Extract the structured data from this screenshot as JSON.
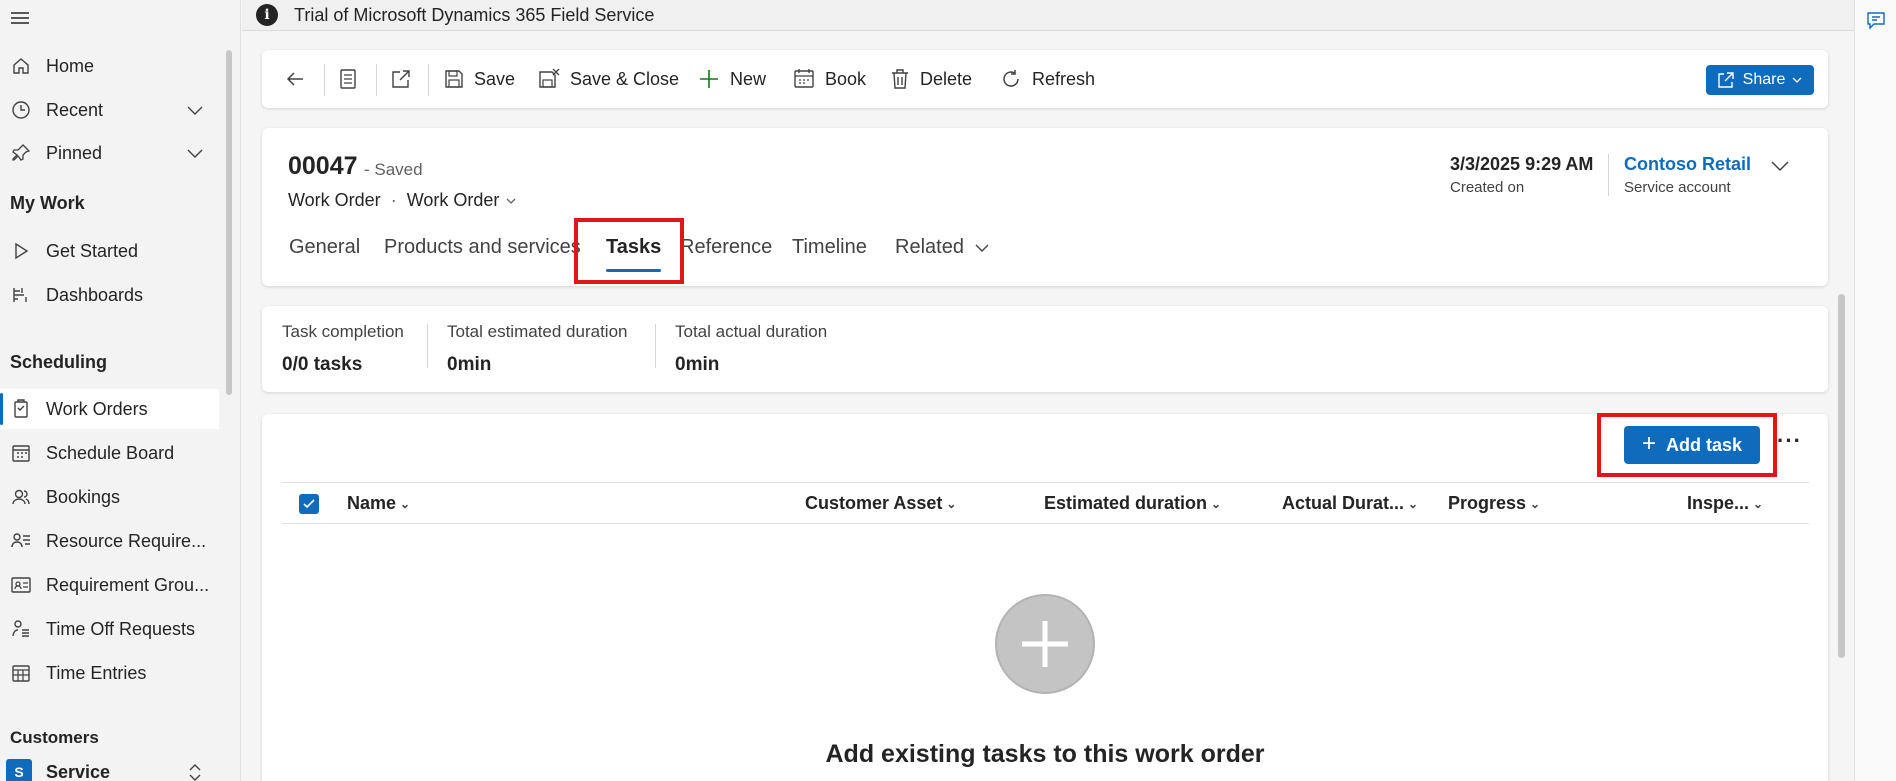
{
  "banner": {
    "text": "Trial of Microsoft Dynamics 365 Field Service"
  },
  "sidebar": {
    "items": [
      {
        "label": "Home"
      },
      {
        "label": "Recent"
      },
      {
        "label": "Pinned"
      }
    ],
    "my_work": {
      "title": "My Work",
      "items": [
        {
          "label": "Get Started"
        },
        {
          "label": "Dashboards"
        }
      ]
    },
    "scheduling": {
      "title": "Scheduling",
      "items": [
        {
          "label": "Work Orders"
        },
        {
          "label": "Schedule Board"
        },
        {
          "label": "Bookings"
        },
        {
          "label": "Resource Require..."
        },
        {
          "label": "Requirement Grou..."
        },
        {
          "label": "Time Off Requests"
        },
        {
          "label": "Time Entries"
        }
      ]
    },
    "customers": {
      "title": "Customers"
    },
    "area": {
      "badge": "S",
      "label": "Service"
    }
  },
  "commands": {
    "save": "Save",
    "save_close": "Save & Close",
    "new": "New",
    "book": "Book",
    "delete": "Delete",
    "refresh": "Refresh",
    "share": "Share"
  },
  "record": {
    "id": "00047",
    "status": "- Saved",
    "entity": "Work Order",
    "form": "Work Order",
    "created_on_value": "3/3/2025 9:29 AM",
    "created_on_label": "Created on",
    "account_value": "Contoso Retail",
    "account_label": "Service account"
  },
  "tabs": [
    {
      "label": "General"
    },
    {
      "label": "Products and services"
    },
    {
      "label": "Tasks"
    },
    {
      "label": "Reference"
    },
    {
      "label": "Timeline"
    },
    {
      "label": "Related"
    }
  ],
  "summary": {
    "task_completion_label": "Task completion",
    "task_completion_value": "0/0 tasks",
    "est_duration_label": "Total estimated duration",
    "est_duration_value": "0min",
    "act_duration_label": "Total actual duration",
    "act_duration_value": "0min"
  },
  "grid": {
    "add_task": "Add task",
    "more": "···",
    "columns": [
      "Name",
      "Customer Asset",
      "Estimated duration",
      "Actual Durat...",
      "Progress",
      "Inspe..."
    ],
    "empty_title": "Add existing tasks to this work order"
  },
  "colors": {
    "accent": "#0f6cbd",
    "highlight": "#e0151a"
  }
}
